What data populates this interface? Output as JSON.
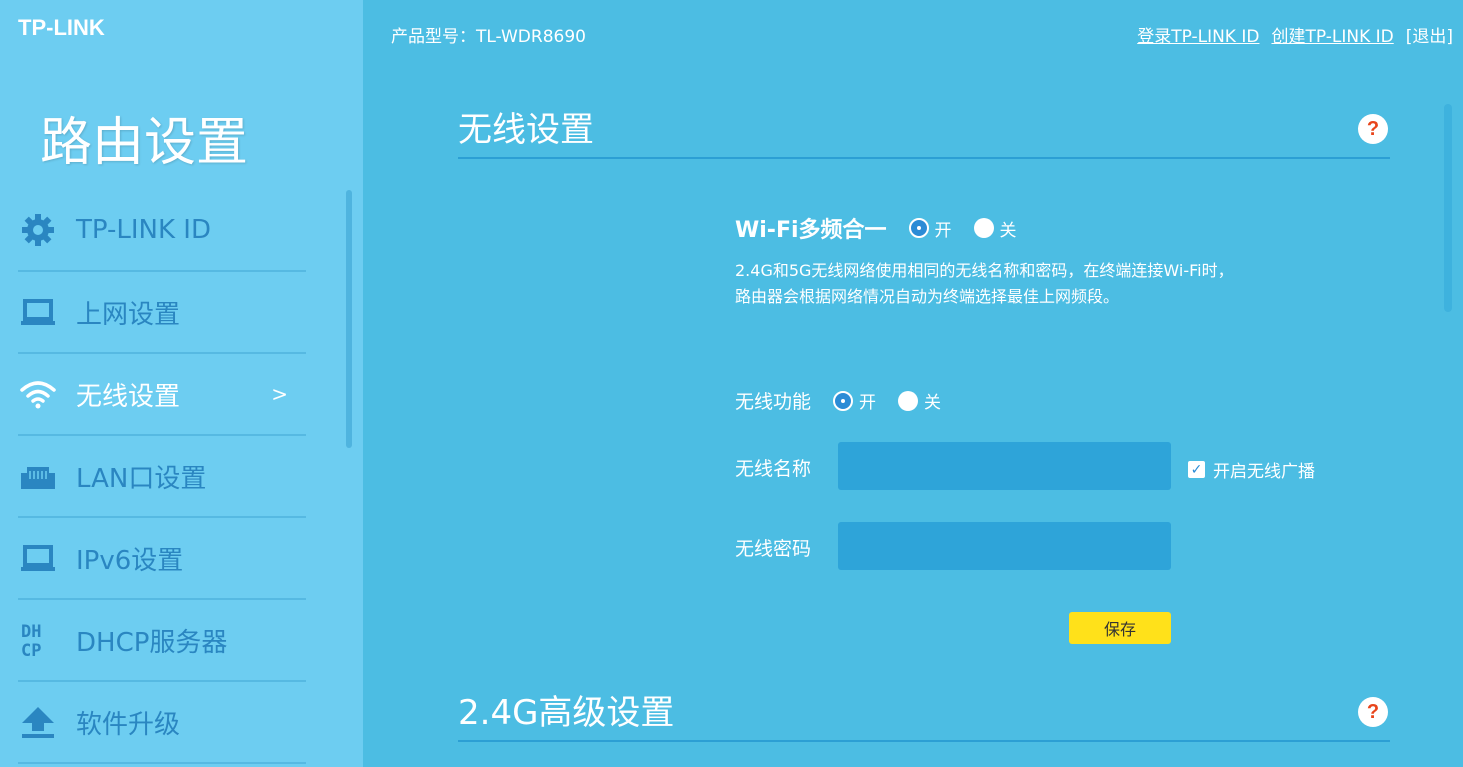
{
  "brand": {
    "logo": "TP-LINK"
  },
  "sidebar": {
    "title": "路由设置",
    "items": [
      {
        "label": "TP-LINK ID",
        "icon": "gear-icon"
      },
      {
        "label": "上网设置",
        "icon": "laptop-icon"
      },
      {
        "label": "无线设置",
        "icon": "wifi-icon",
        "active": true,
        "arrow": ">"
      },
      {
        "label": "LAN口设置",
        "icon": "ethernet-icon"
      },
      {
        "label": "IPv6设置",
        "icon": "laptop-icon"
      },
      {
        "label": "DHCP服务器",
        "icon": "dhcp-icon",
        "icon_text": "DHCP"
      },
      {
        "label": "软件升级",
        "icon": "upload-icon"
      }
    ]
  },
  "header": {
    "product_model": "产品型号：TL-WDR8690",
    "login_link": "登录TP-LINK ID",
    "create_link": "创建TP-LINK ID",
    "logout": "[退出]"
  },
  "wireless_section": {
    "title": "无线设置",
    "help": "?",
    "multi_band": {
      "label": "Wi-Fi多频合一",
      "on": "开",
      "off": "关",
      "selected": "on"
    },
    "description_line1": "2.4G和5G无线网络使用相同的无线名称和密码，在终端连接Wi-Fi时，",
    "description_line2": "路由器会根据网络情况自动为终端选择最佳上网频段。",
    "wireless_function": {
      "label": "无线功能",
      "on": "开",
      "off": "关",
      "selected": "on"
    },
    "ssid": {
      "label": "无线名称",
      "value": ""
    },
    "broadcast": {
      "label": "开启无线广播",
      "checked": true
    },
    "password": {
      "label": "无线密码",
      "value": ""
    },
    "save": "保存"
  },
  "advanced_section": {
    "title": "2.4G高级设置",
    "help": "?"
  },
  "colors": {
    "main_bg": "#4cbde3",
    "sidebar_bg": "#6dcdf1",
    "accent": "#2b8cd6",
    "save_button": "#ffe11a",
    "help_mark": "#e8451c"
  }
}
